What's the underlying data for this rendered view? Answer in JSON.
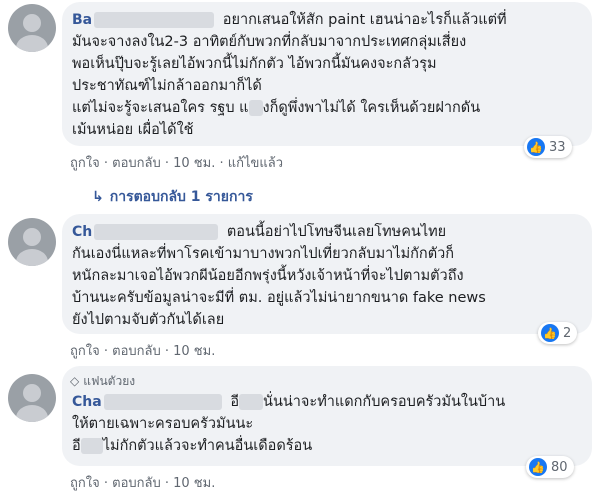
{
  "comments": [
    {
      "author_visible": "Ba",
      "lines": [
        "อยากเสนอให้สัก paint เฮนน่าอะไรก็แล้วแต่ที่",
        "มันจะจางลงใน2-3 อาทิตย์กับพวกที่กลับมาจากประเทศกลุ่มเสี่ยง",
        "พอเห็นปุ๊บจะรู้เลยไอ้พวกนี้ไม่กักตัว  ไอ้พวกนี้มันคงจะกลัวรุม",
        "ประชาทัณฑ์ไม่กล้าออกมาก็ได้",
        "แต่ไม่จะรู้จะเสนอใคร รฐบ แ",
        "งก็ดูพึ่งพาไม่ได้  ใครเห็นด้วยฝากดัน",
        "เม้นหน่อย  เผื่อได้ใช้"
      ],
      "like_label": "ถูกใจ",
      "reply_label": "ตอบกลับ",
      "time": "10 ชม.",
      "edited": "แก้ไขแล้ว",
      "reaction_count": "33",
      "replies_label": "การตอบกลับ 1 รายการ"
    },
    {
      "author_visible": "Ch",
      "lines": [
        "ตอนนี้อย่าไปโทษจีนเลยโทษคนไทย",
        "กันเองนี่แหละที่พาโรคเข้ามาบางพวกไปเที่ยวกลับมาไม่กักตัวก็",
        "หนักละมาเจอไอ้พวกผีน้อยอีกพรุ่งนี้หวังเจ้าหน้าที่จะไปตามตัวถึง",
        "บ้านนะครับข้อมูลน่าจะมีที่ ตม. อยู่แล้วไม่น่ายากขนาด fake news",
        "ยังไปตามจับตัวกันได้เลย"
      ],
      "like_label": "ถูกใจ",
      "reply_label": "ตอบกลับ",
      "time": "10 ชม.",
      "reaction_count": "2"
    },
    {
      "badge": "แฟนตัวยง",
      "author_visible": "Cha",
      "lines": [
        "อี",
        "นั่นน่าจะทำแดกกับครอบครัวมันในบ้าน",
        "ให้ตายเฉพาะครอบครัวมันนะ",
        "อี",
        "ไม่กักตัวแล้วจะทำคนอื่นเดือดร้อน"
      ],
      "like_label": "ถูกใจ",
      "reply_label": "ตอบกลับ",
      "time": "10 ชม.",
      "reaction_count": "80"
    }
  ],
  "icons": {
    "reply-arrow": "↳",
    "like": "👍",
    "badge": "◇"
  },
  "colors": {
    "name": "#365899",
    "bubble": "#f0f2f5",
    "like": "#1877f2"
  }
}
